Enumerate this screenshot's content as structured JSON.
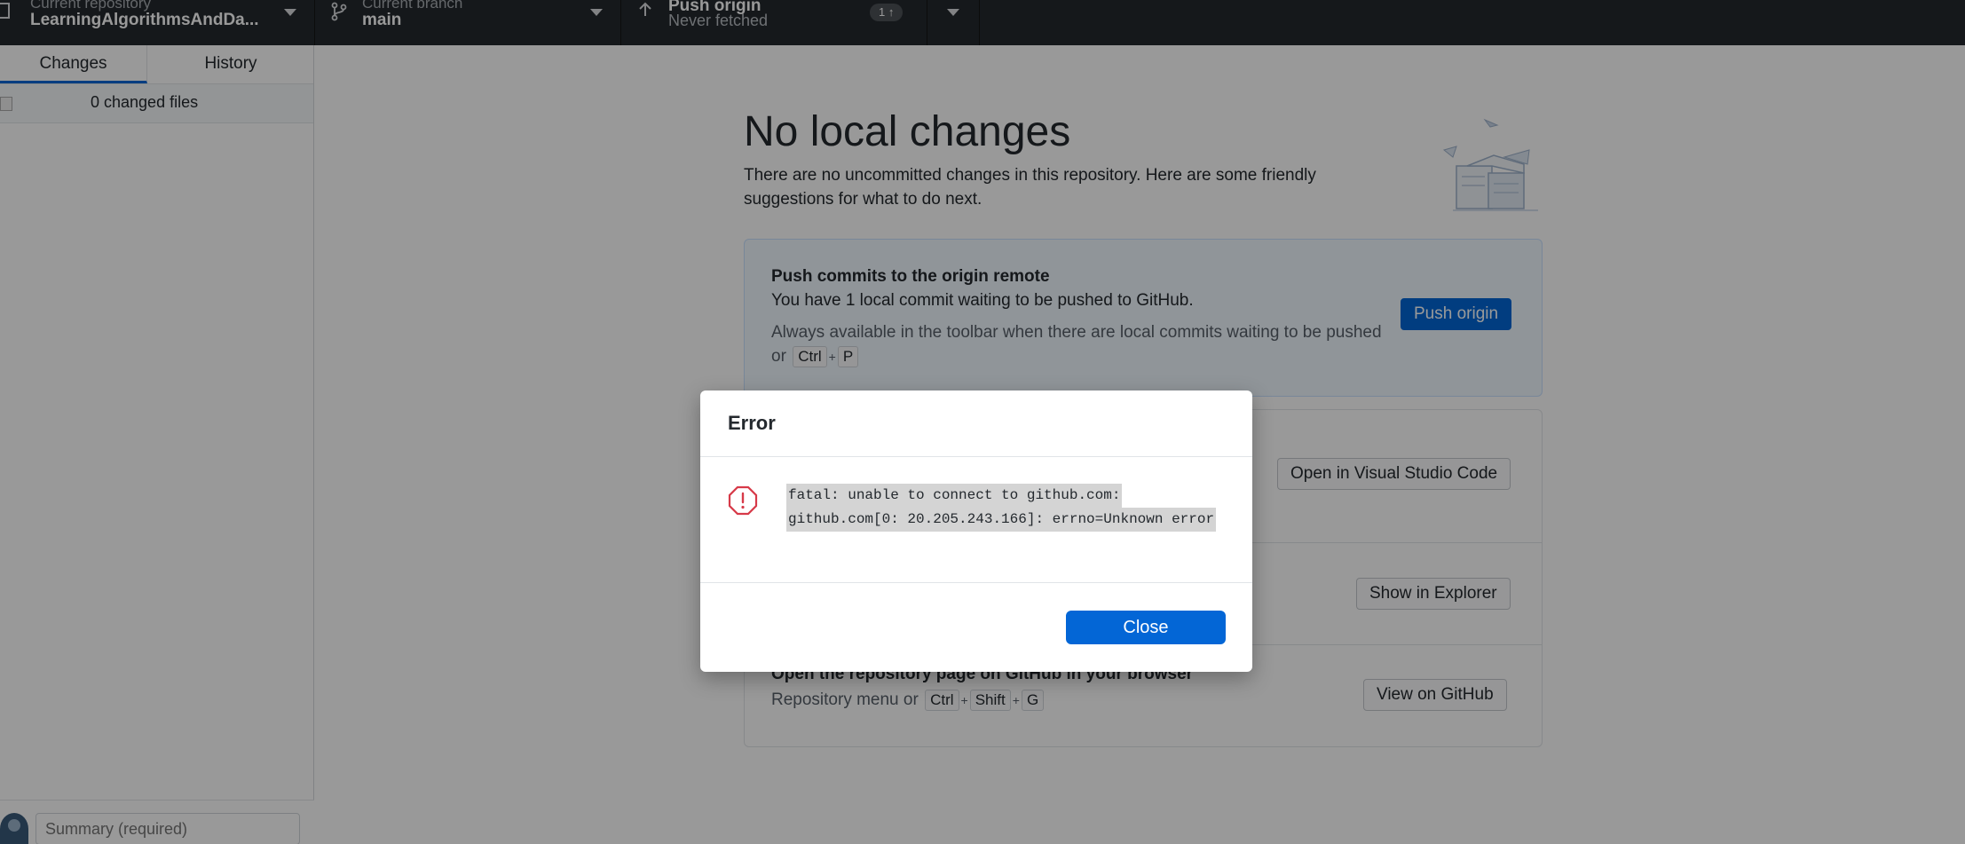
{
  "toolbar": {
    "repo_label": "Current repository",
    "repo_value": "LearningAlgorithmsAndDa...",
    "branch_label": "Current branch",
    "branch_value": "main",
    "push_label": "Push origin",
    "push_sub": "Never fetched",
    "push_badge": "1 ↑"
  },
  "sidebar": {
    "tabs": [
      {
        "label": "Changes"
      },
      {
        "label": "History"
      }
    ],
    "changed_files": "0 changed files",
    "summary_placeholder": "Summary (required)"
  },
  "main": {
    "title": "No local changes",
    "description": "There are no uncommitted changes in this repository. Here are some friendly suggestions for what to do next.",
    "push_card": {
      "title": "Push commits to the origin remote",
      "subtitle": "You have 1 local commit waiting to be pushed to GitHub.",
      "hint": "Always available in the toolbar when there are local commits waiting to be pushed or",
      "shortcut": [
        "Ctrl",
        "P"
      ],
      "button": "Push origin"
    },
    "editor_button": "Open in Visual Studio Code",
    "explorer_button": "Show in Explorer",
    "github_card": {
      "title": "Open the repository page on GitHub in your browser",
      "hint": "Repository menu or",
      "shortcut": [
        "Ctrl",
        "Shift",
        "G"
      ],
      "button": "View on GitHub"
    }
  },
  "dialog": {
    "title": "Error",
    "message_line1": "fatal: unable to connect to github.com:",
    "message_line2": "github.com[0: 20.205.243.166]: errno=Unknown error",
    "close_label": "Close",
    "icon": "alert-octagon-icon",
    "accent": "#d73a49"
  },
  "colors": {
    "toolbar_bg": "#24292e",
    "primary": "#0366d6"
  }
}
